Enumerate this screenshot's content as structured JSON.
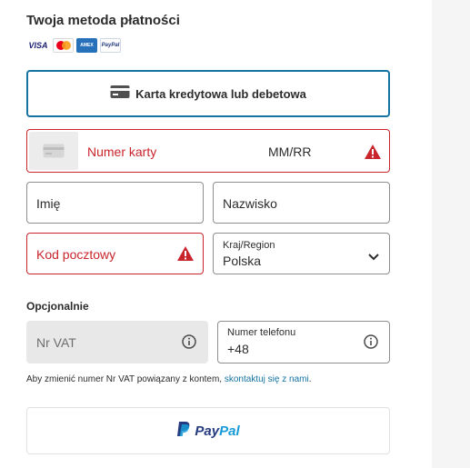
{
  "header": {
    "title": "Twoja metoda płatności"
  },
  "card_logos": [
    {
      "name": "visa",
      "text": "VISA"
    },
    {
      "name": "mastercard",
      "text": ""
    },
    {
      "name": "amex",
      "text": "AMEX"
    },
    {
      "name": "paypal",
      "text": "PayPal"
    }
  ],
  "method_button": {
    "label": "Karta kredytowa lub debetowa",
    "icon": "credit-card-icon"
  },
  "card_field": {
    "number_label": "Numer karty",
    "expiry_label": "MM/RR",
    "icon": "warning-icon"
  },
  "first_name": {
    "placeholder": "Imię"
  },
  "last_name": {
    "placeholder": "Nazwisko"
  },
  "postal_code": {
    "placeholder": "Kod pocztowy"
  },
  "country": {
    "label": "Kraj/Region",
    "value": "Polska"
  },
  "optional": {
    "heading": "Opcjonalnie"
  },
  "vat": {
    "placeholder": "Nr VAT"
  },
  "phone": {
    "label": "Numer telefonu",
    "value": "+48"
  },
  "note": {
    "text": "Aby zmienić numer Nr VAT powiązany z kontem, ",
    "link": "skontaktuj się z nami",
    "suffix": "."
  },
  "paypal_button": {
    "part1": "Pay",
    "part2": "Pal"
  },
  "colors": {
    "accent": "#1473a1",
    "error": "#c9252c",
    "disabled_bg": "#e8e8e8"
  }
}
